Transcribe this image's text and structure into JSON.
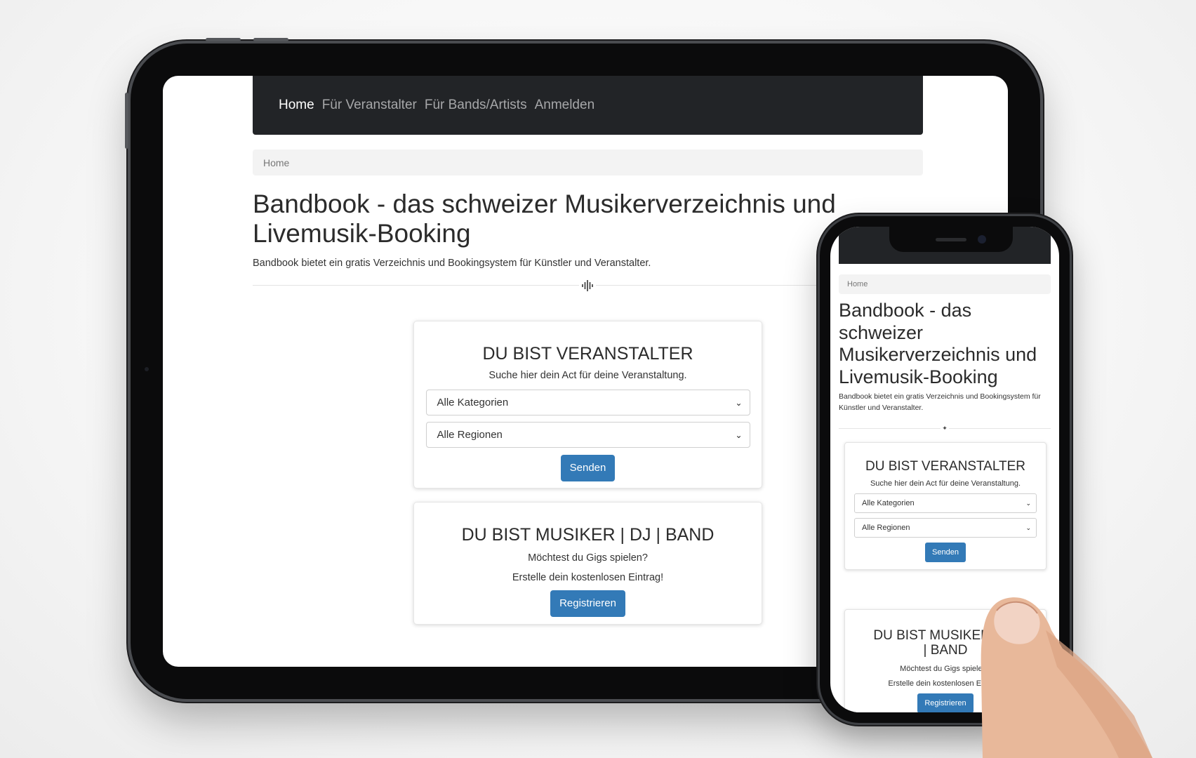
{
  "site": {
    "nav": [
      {
        "label": "Home",
        "active": true
      },
      {
        "label": "Für Veranstalter",
        "active": false
      },
      {
        "label": "Für Bands/Artists",
        "active": false
      },
      {
        "label": "Anmelden",
        "active": false
      }
    ],
    "breadcrumb": "Home",
    "title": "Bandbook - das schweizer Musikerverzeichnis und Livemusik-Booking",
    "lead": "Bandbook bietet ein gratis Verzeichnis und Bookingsystem für Künstler und Veranstalter.",
    "organizer_card": {
      "heading": "DU BIST VERANSTALTER",
      "text": "Suche hier dein Act für deine Veranstaltung.",
      "category_select": "Alle Kategorien",
      "region_select": "Alle Regionen",
      "button": "Senden"
    },
    "musician_card": {
      "heading": "DU BIST MUSIKER | DJ | BAND",
      "text1": "Möchtest du Gigs spielen?",
      "text2": "Erstelle dein kostenlosen Eintrag!",
      "button": "Registrieren"
    }
  },
  "phone_view": {
    "breadcrumb": "Home",
    "title": "Bandbook - das schweizer Musikerverzeichnis und Livemusik-Booking",
    "lead": "Bandbook bietet ein gratis Verzeichnis und Bookingsystem für Künstler und Veranstalter.",
    "organizer_card": {
      "heading": "DU BIST VERANSTALTER",
      "text": "Suche hier dein Act für deine Veranstaltung.",
      "category_select": "Alle Kategorien",
      "region_select": "Alle Regionen",
      "button": "Senden"
    },
    "musician_card": {
      "heading": "DU BIST MUSIKER | DJ | BAND",
      "text1": "Möchtest du Gigs spielen?",
      "text2": "Erstelle dein kostenlosen Eintrag!",
      "button": "Registrieren"
    }
  },
  "colors": {
    "navbar": "#222427",
    "primary_button": "#337ab7",
    "breadcrumb_bg": "#f3f3f3"
  },
  "icons": {
    "divider": "waveform-icon",
    "select": "chevron-down-icon"
  }
}
